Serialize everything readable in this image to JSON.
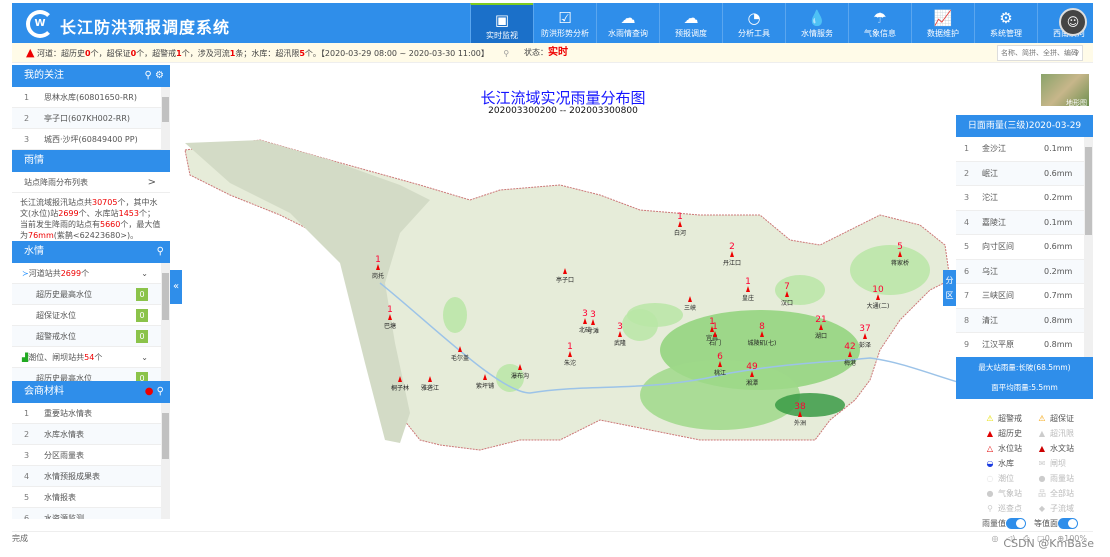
{
  "header": {
    "title": "长江防洪预报调度系统",
    "logo_text": "W",
    "nav": [
      {
        "label": "实时监视",
        "icon": "monitor-icon",
        "glyph": "▣",
        "active": true
      },
      {
        "label": "防洪形势分析",
        "icon": "checkbox-screen-icon",
        "glyph": "☑"
      },
      {
        "label": "水雨情查询",
        "icon": "rain-cloud-icon",
        "glyph": "☁"
      },
      {
        "label": "预报调度",
        "icon": "rain-cloud-icon",
        "glyph": "☁"
      },
      {
        "label": "分析工具",
        "icon": "gauge-icon",
        "glyph": "◔"
      },
      {
        "label": "水情服务",
        "icon": "water-drop-icon",
        "glyph": "💧"
      },
      {
        "label": "气象信息",
        "icon": "umbrella-icon",
        "glyph": "☂"
      },
      {
        "label": "数据维护",
        "icon": "chart-board-icon",
        "glyph": "📈"
      },
      {
        "label": "系统管理",
        "icon": "gear-icon",
        "glyph": "⚙"
      },
      {
        "label": "西南演河",
        "icon": "river-icon",
        "glyph": "≋"
      }
    ]
  },
  "alert": {
    "p1": "河道：超历史",
    "v1": "0",
    "p2": "个，超保证",
    "v2": "0",
    "p3": "个，超警戒",
    "v3": "1",
    "p4": "个，涉及河流",
    "v4": "1",
    "p5": "条；水库：超汛限",
    "v5": "5",
    "p6": "个。【2020-03-29 08:00 ~ 2020-03-30 11:00】",
    "status_label": "状态：",
    "status_value": "实时",
    "search_placeholder": "名称、简拼、全拼、编码"
  },
  "focus": {
    "title": "我的关注",
    "items": [
      {
        "n": "1",
        "label": "思林水库(60801650-RR)"
      },
      {
        "n": "2",
        "label": "亭子口(607KH002-RR)"
      },
      {
        "n": "3",
        "label": "城西·沙坪(60849400 PP)"
      }
    ]
  },
  "rain": {
    "title": "雨情",
    "list_link": "站点降雨分布列表",
    "s1": "长江流域报汛站点共",
    "total": "30705",
    "s2": "个，其中水文(水位)站",
    "hydro": "2699",
    "s3": "个、水库站",
    "res": "1453",
    "s4": "个；当前发生降雨的站点有",
    "raining": "5660",
    "s5": "个，最大值为",
    "max": "76mm",
    "s6": "(紫鹊<62423680>)。"
  },
  "water": {
    "title": "水情",
    "groups": [
      {
        "pre": "河道站共",
        "count": "2699",
        "post": "个",
        "items": [
          {
            "label": "超历史最高水位",
            "value": "0"
          },
          {
            "label": "超保证水位",
            "value": "0"
          },
          {
            "label": "超警戒水位",
            "value": "0"
          }
        ]
      },
      {
        "pre": "潮位、闸坝站共",
        "count": "54",
        "post": "个",
        "items": [
          {
            "label": "超历史最高水位",
            "value": "0"
          }
        ]
      }
    ]
  },
  "consult": {
    "title": "会商材料",
    "items": [
      {
        "n": "1",
        "label": "重要站水情表"
      },
      {
        "n": "2",
        "label": "水库水情表"
      },
      {
        "n": "3",
        "label": "分区雨量表"
      },
      {
        "n": "4",
        "label": "水情预报成果表"
      },
      {
        "n": "5",
        "label": "水情报表"
      },
      {
        "n": "6",
        "label": "水资源监测"
      }
    ]
  },
  "map": {
    "title": "长江流域实况雨量分布图",
    "subtitle": "202003300200 -- 202003300800",
    "terrain_label": "地形图",
    "fenqu": "分区",
    "stations": [
      {
        "name": "岗托",
        "v": "1"
      },
      {
        "name": "巴塘",
        "v": "1"
      },
      {
        "name": "雅砻江",
        "v": ""
      },
      {
        "name": "桐子林",
        "v": ""
      },
      {
        "name": "毛尔盖",
        "v": ""
      },
      {
        "name": "紫坪铺",
        "v": ""
      },
      {
        "name": "瀑布沟",
        "v": ""
      },
      {
        "name": "亭子口",
        "v": ""
      },
      {
        "name": "寸滩",
        "v": "3"
      },
      {
        "name": "北碚",
        "v": "3"
      },
      {
        "name": "朱沱",
        "v": "1"
      },
      {
        "name": "武隆",
        "v": "3"
      },
      {
        "name": "白河",
        "v": "1"
      },
      {
        "name": "丹江口",
        "v": "2"
      },
      {
        "name": "皇庄",
        "v": "1"
      },
      {
        "name": "三峡",
        "v": ""
      },
      {
        "name": "宜昌",
        "v": "1"
      },
      {
        "name": "汉口",
        "v": "7"
      },
      {
        "name": "城陵矶(七)",
        "v": "8"
      },
      {
        "name": "石门",
        "v": "1"
      },
      {
        "name": "桃江",
        "v": "6"
      },
      {
        "name": "湘潭",
        "v": "49"
      },
      {
        "name": "湖口",
        "v": "21"
      },
      {
        "name": "外洲",
        "v": "38"
      },
      {
        "name": "大通(二)",
        "v": "10"
      },
      {
        "name": "蒋家桥",
        "v": "5"
      },
      {
        "name": "彭泽",
        "v": "37"
      },
      {
        "name": "梅港",
        "v": "42"
      }
    ]
  },
  "daily_rain": {
    "title": "日面雨量(三级)2020-03-29",
    "items": [
      {
        "n": "1",
        "name": "金沙江",
        "v": "0.1mm"
      },
      {
        "n": "2",
        "name": "岷江",
        "v": "0.6mm"
      },
      {
        "n": "3",
        "name": "沱江",
        "v": "0.2mm"
      },
      {
        "n": "4",
        "name": "嘉陵江",
        "v": "0.1mm"
      },
      {
        "n": "5",
        "name": "向寸区间",
        "v": "0.6mm"
      },
      {
        "n": "6",
        "name": "乌江",
        "v": "0.2mm"
      },
      {
        "n": "7",
        "name": "三峡区间",
        "v": "0.7mm"
      },
      {
        "n": "8",
        "name": "清江",
        "v": "0.8mm"
      },
      {
        "n": "9",
        "name": "江汉平原",
        "v": "0.8mm"
      }
    ],
    "max_text": "最大站雨量:长陂(68.5mm)",
    "avg_text": "面平均雨量:5.5mm"
  },
  "legend": {
    "items": [
      {
        "label": "超警戒",
        "icon": "warning-yellow-icon",
        "glyph": "⚠",
        "color": "#e6e000"
      },
      {
        "label": "超保证",
        "icon": "warning-orange-icon",
        "glyph": "⚠",
        "color": "#f5a000"
      },
      {
        "label": "超历史",
        "icon": "triangle-red-icon",
        "glyph": "▲",
        "color": "#e00000"
      },
      {
        "label": "超汛限",
        "icon": "triangle-grey-icon",
        "glyph": "▲",
        "color": "#ccc",
        "dim": true
      },
      {
        "label": "水位站",
        "icon": "triangle-outline-icon",
        "glyph": "△",
        "color": "#e00000"
      },
      {
        "label": "水文站",
        "icon": "triangle-red-icon",
        "glyph": "▲",
        "color": "#cc0000"
      },
      {
        "label": "水库",
        "icon": "reservoir-icon",
        "glyph": "◒",
        "color": "#1a3be0"
      },
      {
        "label": "闸坝",
        "icon": "dam-icon",
        "glyph": "✉",
        "color": "#ccc",
        "dim": true
      },
      {
        "label": "潮位",
        "icon": "tide-icon",
        "glyph": "◌",
        "color": "#ccc",
        "dim": true
      },
      {
        "label": "雨量站",
        "icon": "rain-station-icon",
        "glyph": "●",
        "color": "#ccc",
        "dim": true
      },
      {
        "label": "气象站",
        "icon": "weather-station-icon",
        "glyph": "●",
        "color": "#ccc",
        "dim": true
      },
      {
        "label": "全部站",
        "icon": "hierarchy-icon",
        "glyph": "品",
        "color": "#ccc",
        "dim": true
      },
      {
        "label": "巡查点",
        "icon": "location-pin-icon",
        "glyph": "⚲",
        "color": "#ccc",
        "dim": true
      },
      {
        "label": "子流域",
        "icon": "subbasin-icon",
        "glyph": "◆",
        "color": "#ccc",
        "dim": true
      }
    ],
    "toggle1": "雨量值",
    "toggle2": "等值面"
  },
  "statusbar": {
    "text": "完成",
    "zoom": "100%",
    "count": "0"
  },
  "watermark": "CSDN @KmBase"
}
